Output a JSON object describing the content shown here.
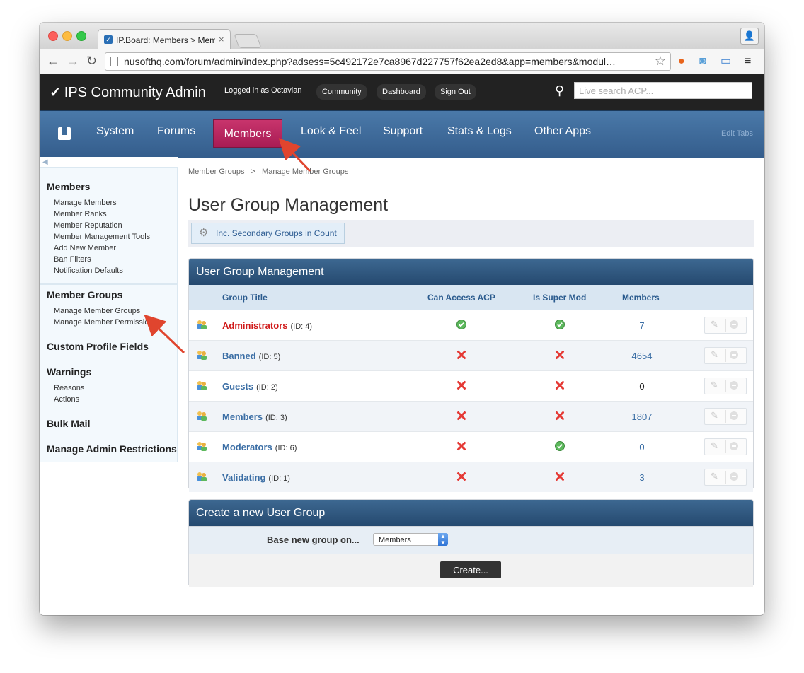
{
  "browser": {
    "tab_title": "IP.Board: Members > Members",
    "url": "nusofthq.com/forum/admin/index.php?adsess=5c492172e7ca8967d227757f62ea2ed8&app=members&modul…"
  },
  "header": {
    "logo_text": "IPS Community Admin",
    "logged_in": "Logged in as Octavian",
    "links": [
      "Community",
      "Dashboard",
      "Sign Out"
    ],
    "search_placeholder": "Live search ACP..."
  },
  "nav": {
    "tabs": [
      "System",
      "Forums",
      "Members",
      "Look & Feel",
      "Support",
      "Stats & Logs",
      "Other Apps"
    ],
    "active": "Members",
    "edit_tabs": "Edit Tabs"
  },
  "sidebar": {
    "sections": [
      {
        "title": "Members",
        "links": [
          "Manage Members",
          "Member Ranks",
          "Member Reputation",
          "Member Management Tools",
          "Add New Member",
          "Ban Filters",
          "Notification Defaults"
        ]
      },
      {
        "title": "Member Groups",
        "links": [
          "Manage Member Groups",
          "Manage Member Permissions"
        ]
      },
      {
        "title": "Custom Profile Fields",
        "links": []
      },
      {
        "title": "Warnings",
        "links": [
          "Reasons",
          "Actions"
        ]
      },
      {
        "title": "Bulk Mail",
        "links": []
      },
      {
        "title": "Manage Admin Restrictions",
        "links": []
      }
    ]
  },
  "main": {
    "breadcrumb": [
      "Member Groups",
      ">",
      "Manage Member Groups"
    ],
    "title": "User Group Management",
    "action_button": "Inc. Secondary Groups in Count",
    "panel_title": "User Group Management",
    "columns": [
      "Group Title",
      "Can Access ACP",
      "Is Super Mod",
      "Members"
    ],
    "groups": [
      {
        "name": "Administrators",
        "id": "(ID: 4)",
        "acp": true,
        "supermod": true,
        "members": "7"
      },
      {
        "name": "Banned",
        "id": "(ID: 5)",
        "acp": false,
        "supermod": false,
        "members": "4654"
      },
      {
        "name": "Guests",
        "id": "(ID: 2)",
        "acp": false,
        "supermod": false,
        "members": "0"
      },
      {
        "name": "Members",
        "id": "(ID: 3)",
        "acp": false,
        "supermod": false,
        "members": "1807"
      },
      {
        "name": "Moderators",
        "id": "(ID: 6)",
        "acp": false,
        "supermod": true,
        "members": "0"
      },
      {
        "name": "Validating",
        "id": "(ID: 1)",
        "acp": false,
        "supermod": false,
        "members": "3"
      }
    ],
    "create_panel": {
      "title": "Create a new User Group",
      "label": "Base new group on...",
      "selected": "Members",
      "button": "Create..."
    }
  },
  "colors": {
    "active_tab": "#b8275f",
    "nav_blue": "#3f6c9b",
    "link_blue": "#3b6ea5",
    "admin_red": "#d01a1a",
    "check_green": "#4caf50",
    "cross_red": "#e53935",
    "arrow_red": "#e0452e"
  }
}
